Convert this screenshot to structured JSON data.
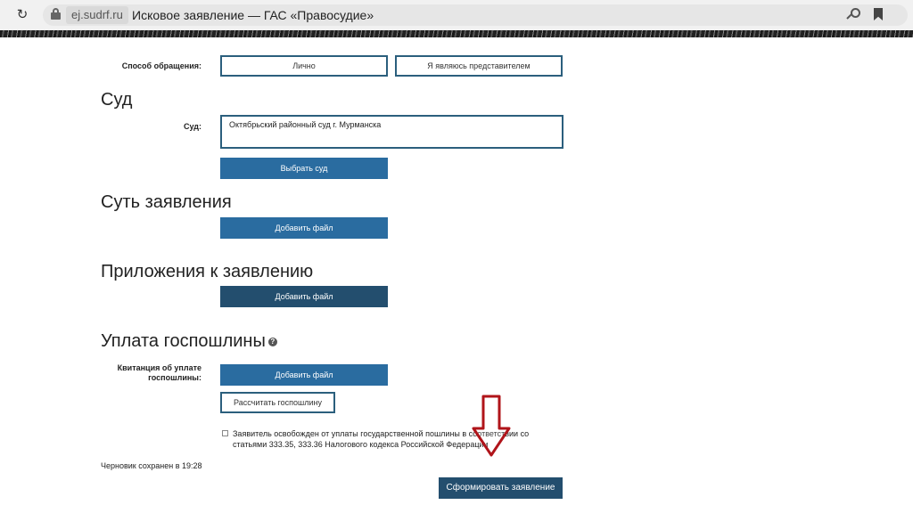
{
  "browser": {
    "domain": "ej.sudrf.ru",
    "tab_title": "Исковое заявление — ГАС «Правосудие»"
  },
  "form": {
    "appeal_method": {
      "label": "Способ обращения:",
      "option_personal": "Лично",
      "option_representative": "Я являюсь представителем"
    },
    "court_section": {
      "heading": "Суд",
      "field_label": "Суд:",
      "field_value": "Октябрьский районный суд г. Мурманска",
      "select_button": "Выбрать суд"
    },
    "claim_section": {
      "heading": "Суть заявления",
      "add_file_button": "Добавить файл"
    },
    "attachments_section": {
      "heading": "Приложения к заявлению",
      "add_file_button": "Добавить файл"
    },
    "fee_section": {
      "heading": "Уплата госпошлины",
      "help_icon": "?",
      "receipt_label_line1": "Квитанция об уплате",
      "receipt_label_line2": "госпошлины:",
      "add_file_button": "Добавить файл",
      "calculate_button": "Рассчитать госпошлину",
      "exempt_checkbox_label": "Заявитель освобожден от уплаты государственной пошлины в соответствии со статьями 333.35, 333.36 Налогового кодекса Российской Федерации"
    },
    "draft_status": "Черновик сохранен в 19:28",
    "submit_button": "Сформировать заявление"
  },
  "colors": {
    "button_blue": "#2a6ca0",
    "button_dark": "#234e6e",
    "outline": "#2b5f7d",
    "annotation_arrow": "#b0141a"
  }
}
